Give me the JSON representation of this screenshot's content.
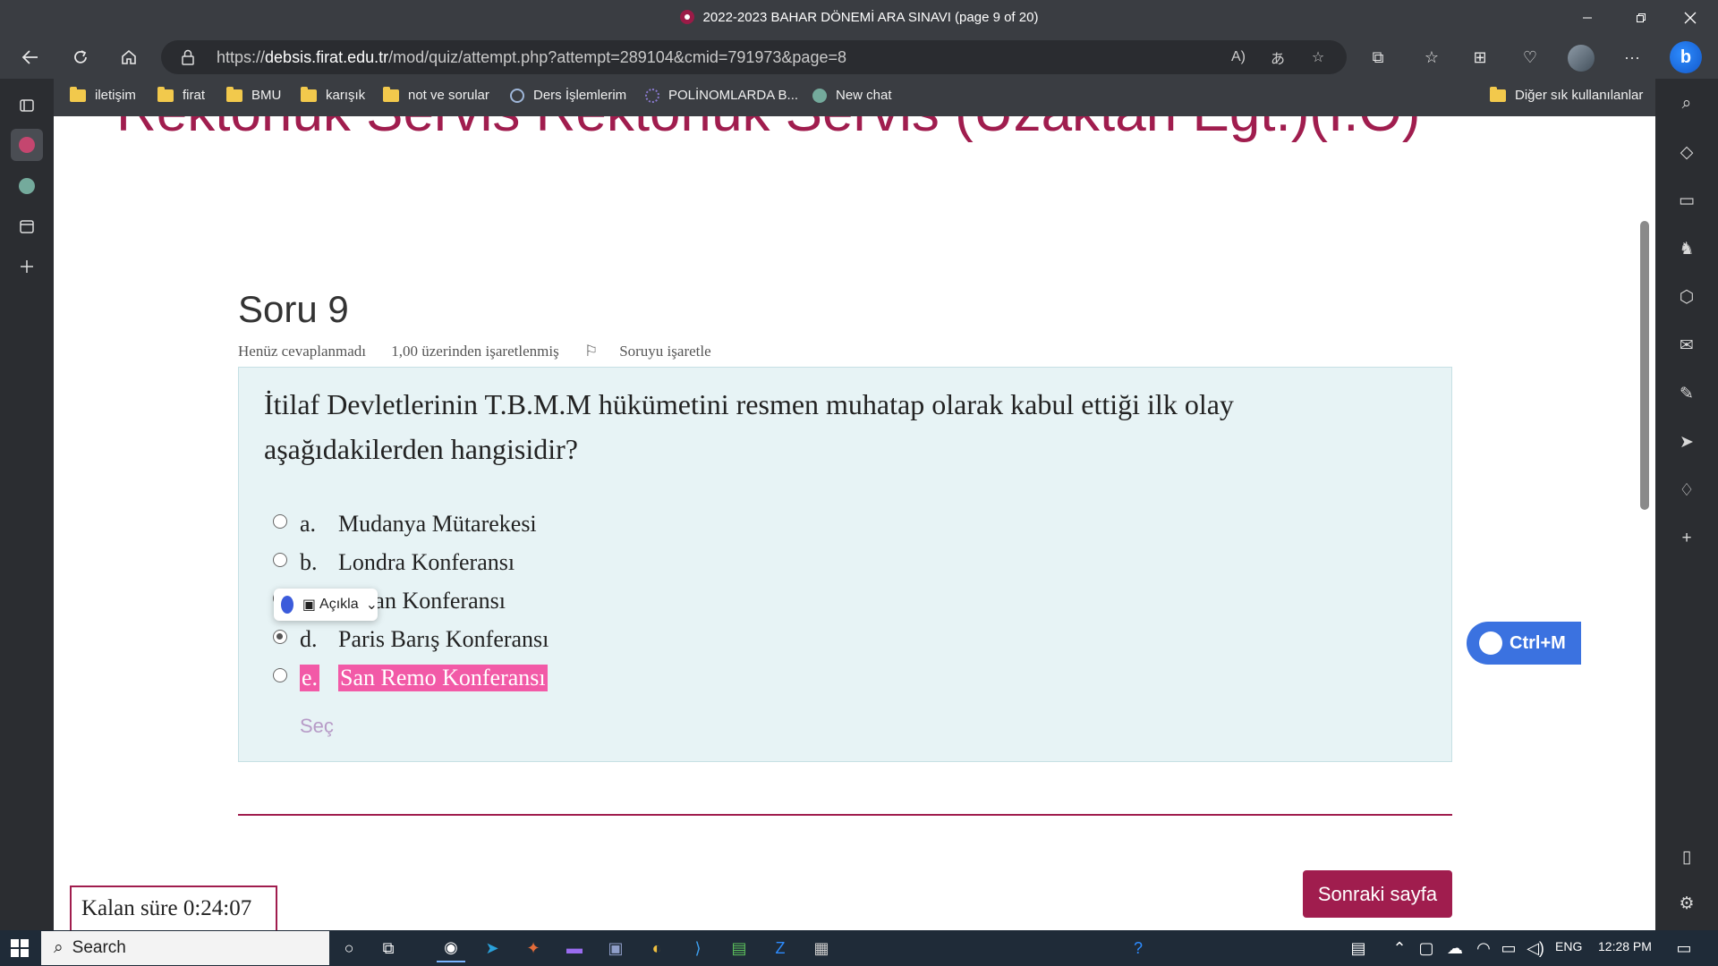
{
  "window": {
    "title": "2022-2023 BAHAR DÖNEMİ ARA SINAVI (page 9 of 20)",
    "controls": [
      "minimize",
      "restore",
      "close"
    ]
  },
  "address_bar": {
    "url_prefix": "https://",
    "url_domain": "debsis.firat.edu.tr",
    "url_path": "/mod/quiz/attempt.php?attempt=289104&cmid=791973&page=8"
  },
  "bookmarks": [
    {
      "label": "iletişim",
      "icon": "folder-icon"
    },
    {
      "label": "firat",
      "icon": "folder-icon"
    },
    {
      "label": "BMU",
      "icon": "folder-icon"
    },
    {
      "label": "karışık",
      "icon": "folder-icon"
    },
    {
      "label": "not ve sorular",
      "icon": "folder-icon"
    },
    {
      "label": "Ders İşlemlerim",
      "icon": "paperclip-icon"
    },
    {
      "label": "POLİNOMLARDA B...",
      "icon": "dots-icon"
    },
    {
      "label": "New chat",
      "icon": "chatgpt-icon"
    }
  ],
  "bookmarks_other": "Diğer sık kullanılanlar",
  "page": {
    "banner": "Rektörlük Servis Rektörlük Servis (Uzaktan Eğt.)(I.Ö)",
    "question_heading": "Soru 9",
    "info": {
      "status": "Henüz cevaplanmadı",
      "points": "1,00 üzerinden işaretlenmiş",
      "flag_label": "Soruyu işaretle"
    },
    "question_text": "İtilaf Devletlerinin T.B.M.M hükümetini resmen muhatap olarak kabul ettiği ilk olay aşağıdakilerden hangisidir?",
    "answers": [
      {
        "letter": "a.",
        "text": "Mudanya Mütarekesi",
        "checked": false
      },
      {
        "letter": "b.",
        "text": "Londra Konferansı",
        "checked": false
      },
      {
        "letter": "c.",
        "text": "Lozan Konferansı",
        "checked": false
      },
      {
        "letter": "d.",
        "text": "Paris Barış Konferansı",
        "checked": true
      },
      {
        "letter": "e.",
        "text": "San Remo Konferansı",
        "checked": false,
        "highlighted": true
      }
    ],
    "clear_choice": "Seç",
    "popup_label": "Açıkla",
    "next_button": "Sonraki sayfa",
    "timer": "Kalan süre 0:24:07",
    "assistant_shortcut": "Ctrl+M"
  },
  "taskbar": {
    "search_placeholder": "Search",
    "language": "ENG",
    "time": "12:28 PM"
  },
  "colors": {
    "brand": "#a01d4e",
    "question_bg": "#e7f3f5",
    "highlight": "#f25aa7",
    "chrome_dark": "#3a3d42"
  }
}
